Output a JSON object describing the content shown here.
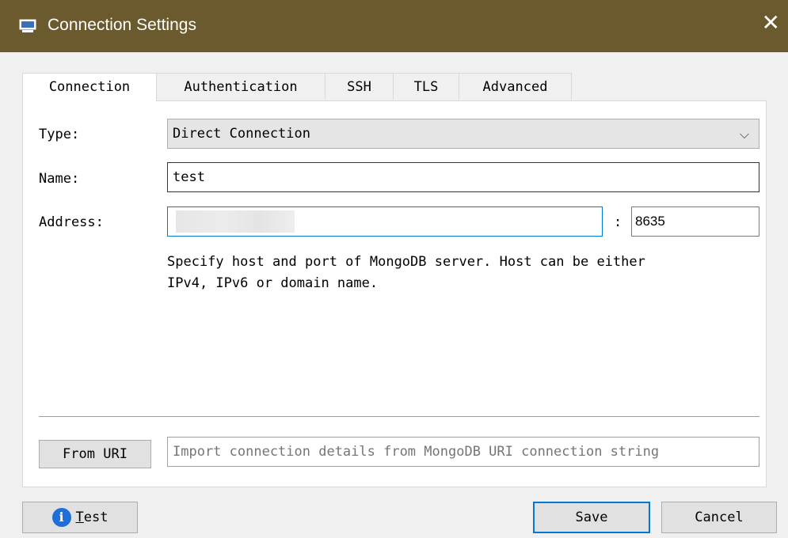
{
  "window": {
    "title": "Connection Settings",
    "close_glyph": "✕",
    "icon": "monitor-icon"
  },
  "tabs": [
    {
      "label": "Connection",
      "active": true
    },
    {
      "label": "Authentication",
      "active": false
    },
    {
      "label": "SSH",
      "active": false
    },
    {
      "label": "TLS",
      "active": false
    },
    {
      "label": "Advanced",
      "active": false
    }
  ],
  "form": {
    "type_label": "Type:",
    "type_value": "Direct Connection",
    "name_label": "Name:",
    "name_value": "test",
    "address_label": "Address:",
    "address_value": "",
    "port_separator": ":",
    "port_value": "8635",
    "hint": "Specify host and port of MongoDB server. Host can be either\nIPv4, IPv6 or domain name."
  },
  "uri": {
    "button_label": "From URI",
    "placeholder": "Import connection details from MongoDB URI connection string"
  },
  "footer": {
    "test_label_prefix": "T",
    "test_label_rest": "est",
    "save_label": "Save",
    "cancel_label": "Cancel"
  },
  "colors": {
    "titlebar": "#6b5a2d",
    "accent": "#0078d7",
    "info": "#1e6fd9"
  }
}
